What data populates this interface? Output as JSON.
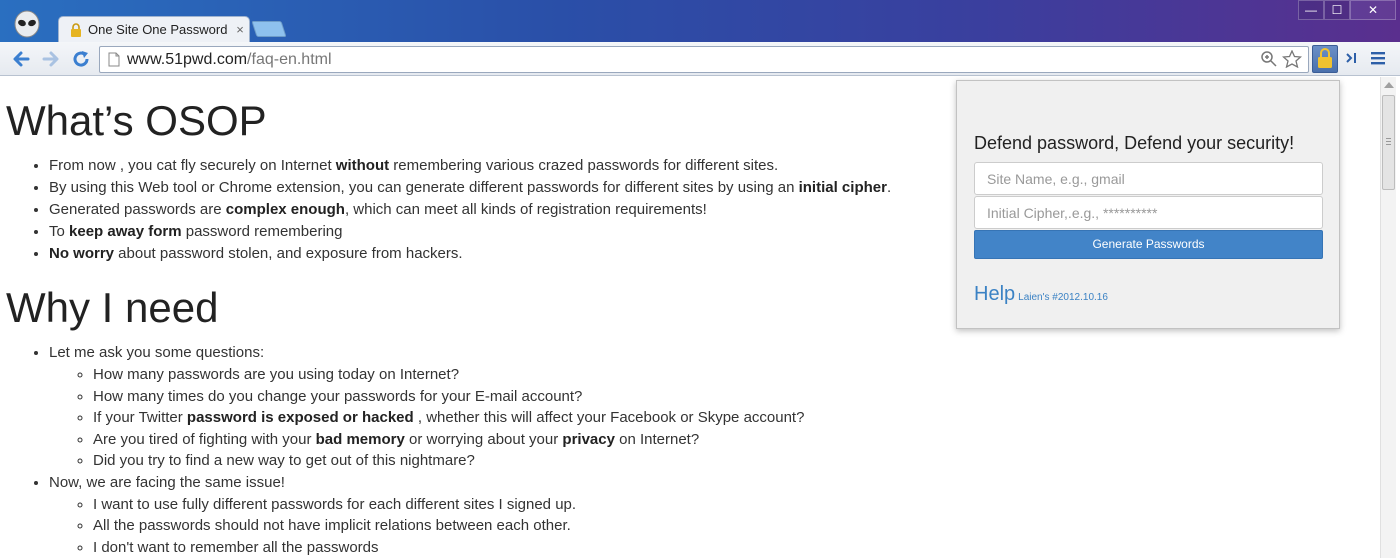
{
  "browser": {
    "tab_title": "One Site One Password",
    "tab_close": "×",
    "url_host": "www.51pwd.com",
    "url_path": "/faq-en.html",
    "window_buttons": {
      "minimize": "—",
      "maximize": "☐",
      "close": "✕"
    }
  },
  "page": {
    "section1": {
      "heading": "What’s OSOP",
      "items": [
        {
          "pre": "From now , you cat fly securely on Internet ",
          "bold": "without",
          "post": " remembering various crazed passwords for different sites."
        },
        {
          "pre": "By using this Web tool or Chrome extension, you can generate different passwords for different sites by using an ",
          "bold": "initial cipher",
          "post": "."
        },
        {
          "pre": "Generated passwords are ",
          "bold": "complex enough",
          "post": ", which can meet all kinds of registration requirements!"
        },
        {
          "pre": "To ",
          "bold": "keep away form",
          "post": " password remembering"
        },
        {
          "pre": "",
          "bold": "No worry",
          "post": " about password stolen, and exposure from hackers."
        }
      ]
    },
    "section2": {
      "heading": "Why I need",
      "intro": "Let me ask you some questions:",
      "questions": [
        {
          "pre": "How many passwords are you using today on Internet?"
        },
        {
          "pre": "How many times do you change your passwords for your E-mail account?"
        },
        {
          "pre": "If your Twitter ",
          "bold": "password is exposed or hacked",
          "post": " , whether this will affect your Facebook or Skype account?"
        },
        {
          "pre": "Are you tired of fighting with your ",
          "bold": "bad memory",
          "mid": " or worrying about your ",
          "bold2": "privacy",
          "post": " on Internet?"
        },
        {
          "pre": "Did you try to find a new way to get out of this nightmare?"
        }
      ],
      "facing": "Now, we are facing the same issue!",
      "issues": [
        "I want to use fully different passwords for each different sites I signed up.",
        "All the passwords should not have implicit relations between each other.",
        "I don't want to remember all the passwords"
      ]
    }
  },
  "popup": {
    "heading": "Defend password, Defend your security!",
    "site_placeholder": "Site Name, e.g., gmail",
    "cipher_placeholder": "Initial Cipher,.e.g., **********",
    "generate_label": "Generate Passwords",
    "help_label": "Help",
    "version": "Laien's #2012.10.16"
  },
  "colors": {
    "accent": "#4284c8",
    "link": "#3b82c4",
    "titlebar_start": "#2a6fc0",
    "titlebar_end": "#5a2f8e"
  }
}
